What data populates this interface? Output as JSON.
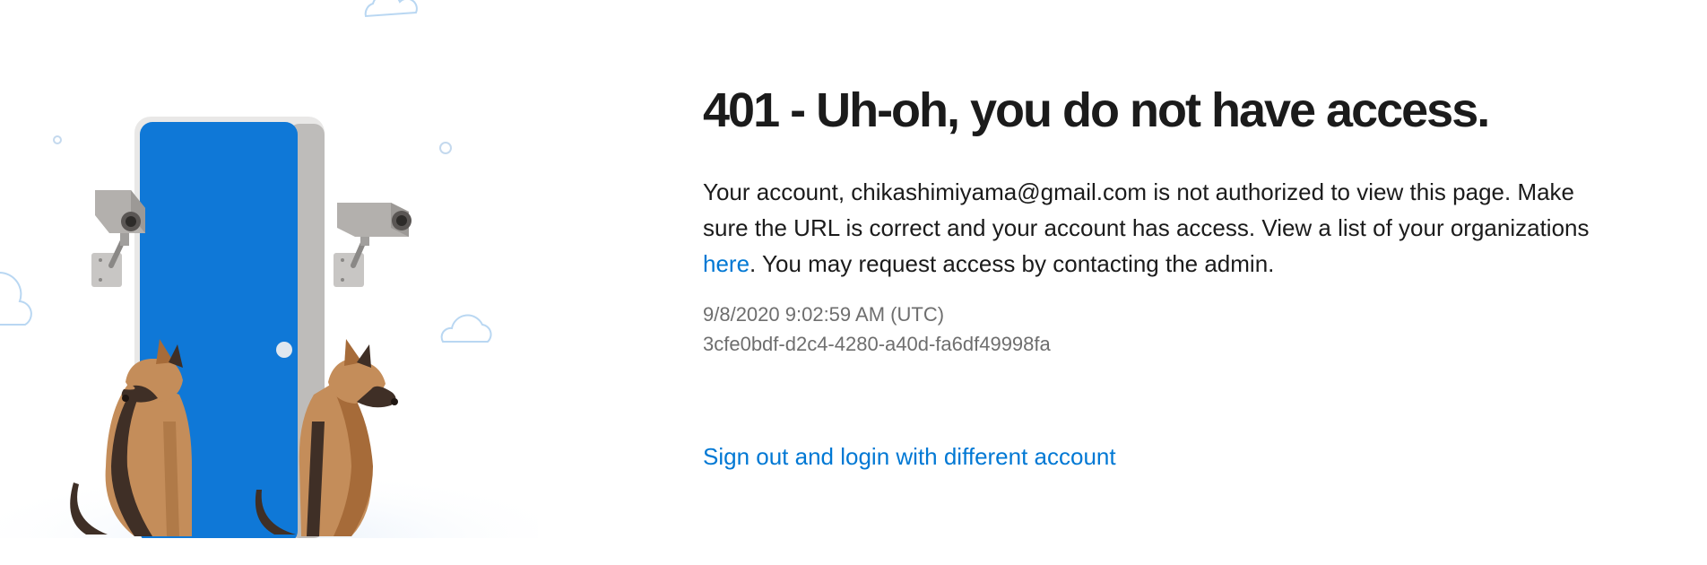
{
  "error": {
    "title": "401 - Uh-oh, you do not have access.",
    "message_before_account": "Your account, ",
    "account": "chikashimiyama@gmail.com",
    "message_middle": " is not authorized to view this page. Make sure the URL is correct and your account has access. View a list of your organizations ",
    "organizations_link": "here",
    "message_after_link": ". You may request access by contacting the admin.",
    "timestamp": "9/8/2020 9:02:59 AM (UTC)",
    "activity_id": "3cfe0bdf-d2c4-4280-a40d-fa6df49998fa",
    "signout_link": "Sign out and login with different account"
  },
  "illustration": {
    "icons": [
      "locked-door-icon",
      "security-camera-icon",
      "guard-dog-icon",
      "cloud-icon"
    ],
    "colors": {
      "door": "#0f78d7",
      "door_frame": "#c8c6c4",
      "camera": "#b3b0ad",
      "dog_tan": "#c48d5a",
      "dog_dark": "#3f2f26",
      "cloud_outline": "#b9d7f2",
      "link": "#0078d4"
    }
  }
}
